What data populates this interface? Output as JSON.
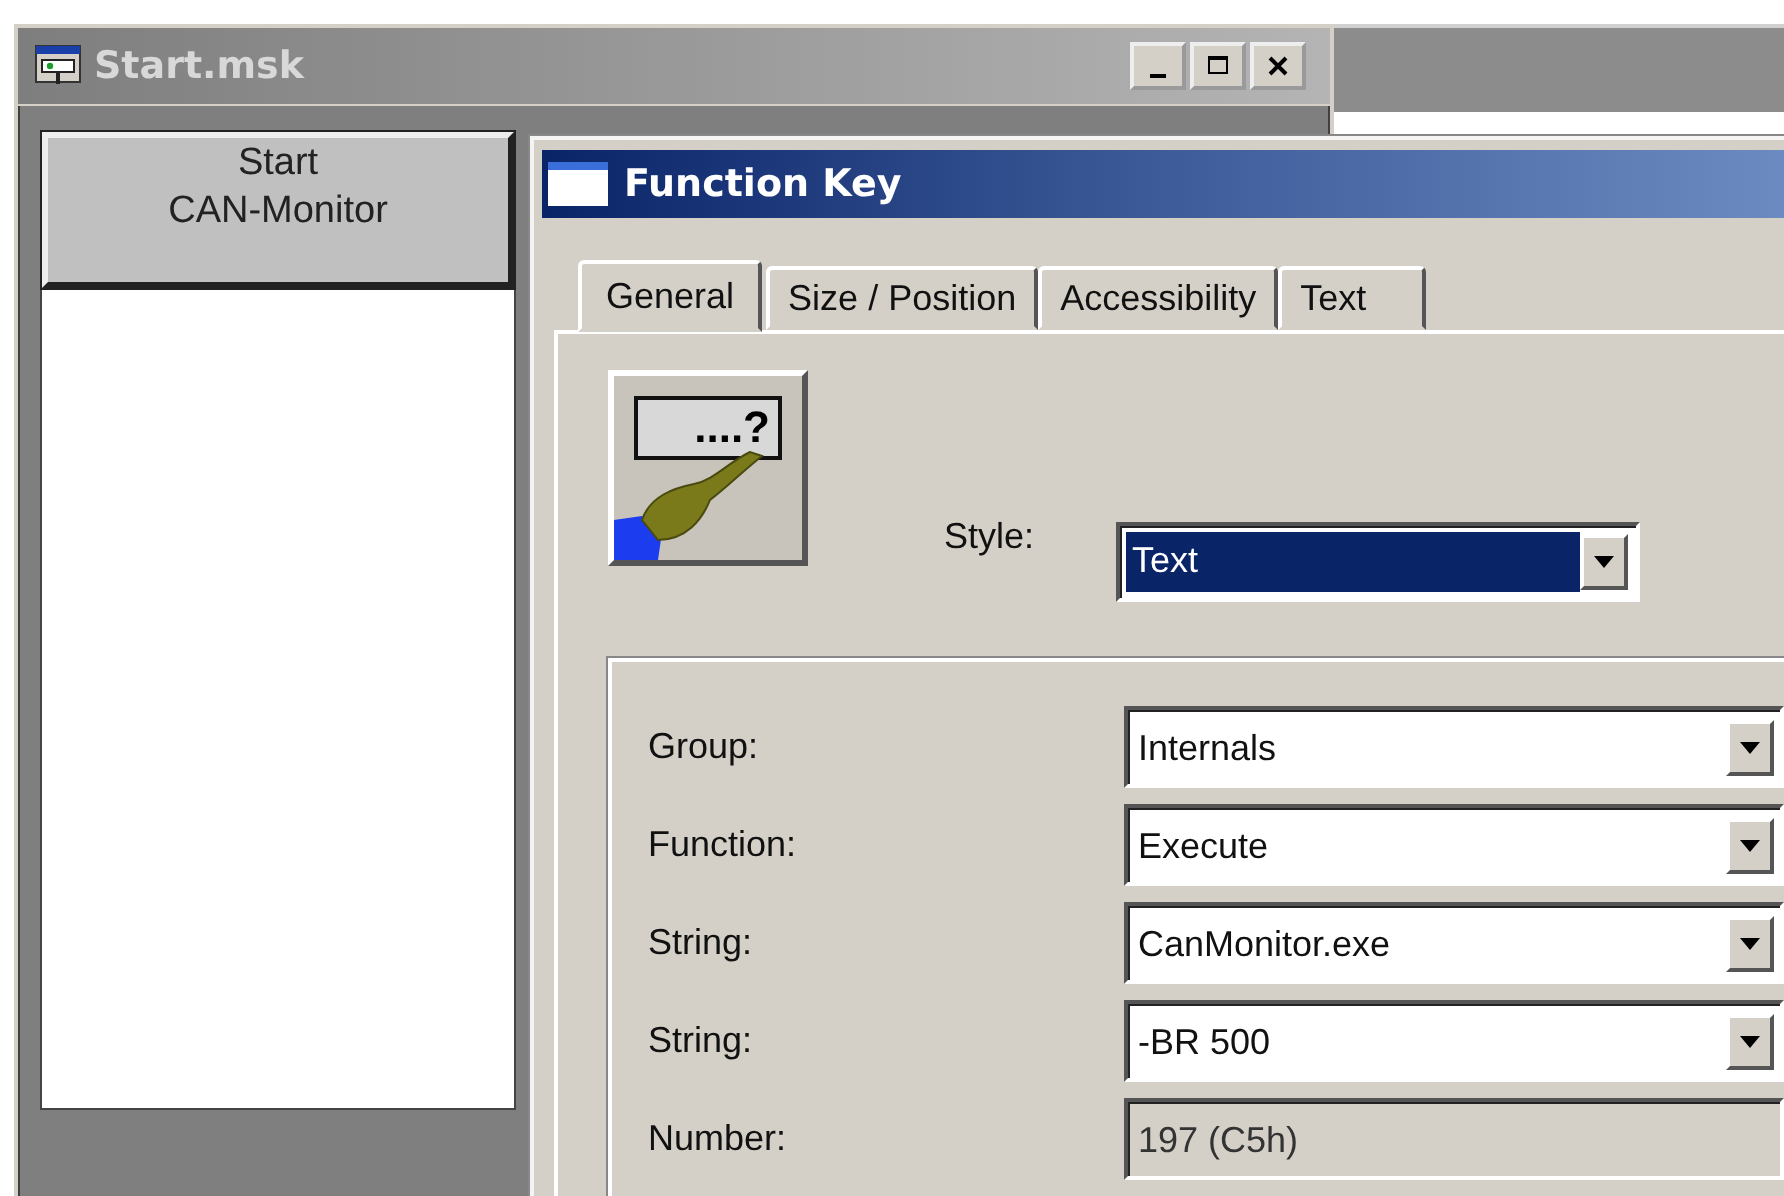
{
  "main_window": {
    "title": "Start.msk",
    "button": {
      "label": "Start\nCAN-Monitor"
    }
  },
  "dialog": {
    "title": "Function Key",
    "tabs": [
      {
        "label": "General",
        "selected": true
      },
      {
        "label": "Size / Position",
        "selected": false
      },
      {
        "label": "Accessibility",
        "selected": false
      },
      {
        "label": "Text",
        "selected": false
      }
    ],
    "key_caption": "....?",
    "style": {
      "label": "Style:",
      "value": "Text",
      "highlighted": true
    },
    "fields": [
      {
        "label": "Group:",
        "value": "Internals",
        "kind": "dropdown"
      },
      {
        "label": "Function:",
        "value": "Execute",
        "kind": "dropdown"
      },
      {
        "label": "String:",
        "value": "CanMonitor.exe",
        "kind": "dropdown"
      },
      {
        "label": "String:",
        "value": "-BR 500",
        "kind": "dropdown"
      },
      {
        "label": "Number:",
        "value": "197 (C5h)",
        "kind": "readonly"
      }
    ]
  }
}
